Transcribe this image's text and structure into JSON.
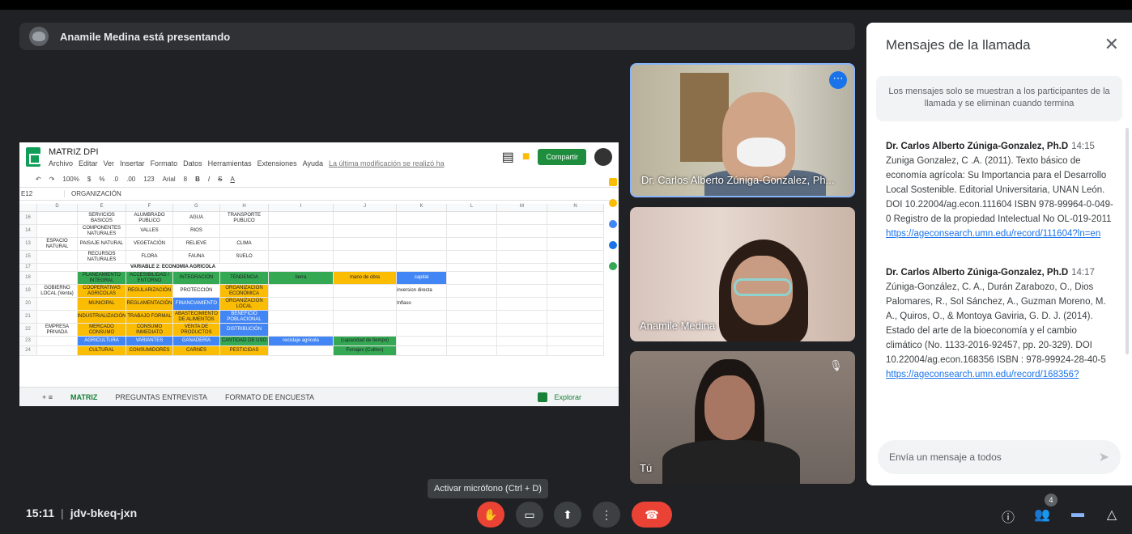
{
  "presenter": {
    "text": "Anamile Medina está presentando"
  },
  "sheet": {
    "title": "MATRIZ DPI",
    "menu": [
      "Archivo",
      "Editar",
      "Ver",
      "Insertar",
      "Formato",
      "Datos",
      "Herramientas",
      "Extensiones",
      "Ayuda"
    ],
    "last_edit": "La última modificación se realizó ha",
    "share_label": "Compartir",
    "toolbar": [
      "100%",
      "$",
      "%",
      ".0",
      ".00",
      "123",
      "Arial",
      "8",
      "B",
      "I",
      "S",
      "A"
    ],
    "cell_ref": "E12",
    "formula": "ORGANIZACIÓN",
    "columns": [
      "D",
      "E",
      "F",
      "G",
      "H",
      "I",
      "J",
      "K",
      "L",
      "M",
      "N"
    ],
    "rows": [
      {
        "n": "16",
        "D": "",
        "E": "SERVICIOS BASICOS",
        "F": "ALUMBRADO PUBLICO",
        "G": "AGUA",
        "H": "TRANSPORTE PUBLICO"
      },
      {
        "n": "14",
        "D": "",
        "E": "COMPONENTES NATURALES",
        "F": "VALLES",
        "G": "RIOS",
        "H": ""
      },
      {
        "n": "13",
        "D": "ESPACIO NATURAL",
        "E": "PAISAJE NATURAL",
        "F": "VEGETACIÓN",
        "G": "RELIEVE",
        "H": "CLIMA"
      },
      {
        "n": "15",
        "D": "",
        "E": "RECURSOS NATURALES",
        "F": "FLORA",
        "G": "FAUNA",
        "H": "SUELO"
      },
      {
        "n": "17",
        "D": "",
        "E": "VARIABLE 2: ECONOMÍA AGRÍCOLA",
        "F": "",
        "G": "",
        "H": ""
      },
      {
        "n": "18",
        "D": "",
        "E": "PLANEAMIENTO INTEGRAL",
        "F": "ACCESIBILIDAD / ENTORNO",
        "G": "INTEGRACIÓN",
        "H": "TENDENCIA",
        "I": "tierra",
        "J": "mano de obra",
        "K": "capital"
      },
      {
        "n": "19",
        "D": "GOBIERNO LOCAL (Venta)",
        "E": "COOPERATIVAS AGRICOLAS",
        "F": "REGULARIZACIÓN",
        "G": "PROTECCIÓN",
        "H": "ORGANIZACIÓN ECONÓMICA",
        "K": "inversion directa"
      },
      {
        "n": "20",
        "D": "",
        "E": "MUNICIPAL",
        "F": "REGLAMENTACIÓN",
        "G": "FINANCIAMIENTO",
        "H": "ORGANIZACIÓN LOCAL",
        "K": "Inflaso"
      },
      {
        "n": "21",
        "D": "",
        "E": "INDUSTRIALIZACIÓN",
        "F": "TRABAJO FORMAL",
        "G": "ABASTECIMIENTO DE ALIMENTOS",
        "H": "BENEFICIO POBLACIONAL"
      },
      {
        "n": "22",
        "D": "EMPRESA PRIVADA",
        "E": "MERCADO CONSUMO",
        "F": "CONSUMO INMEDIATO",
        "G": "VENTA DE PRODUCTOS",
        "H": "DISTRIBUCIÓN"
      },
      {
        "n": "23",
        "D": "",
        "E": "AGRICULTURA",
        "F": "VARIANTES",
        "G": "GANADERÍA",
        "H": "CANTIDAD DE USO",
        "I": "reciclaje agricola",
        "J": "(capacidad de tiempo)"
      },
      {
        "n": "24",
        "D": "",
        "E": "CULTURAL",
        "F": "CONSUMIDORES",
        "G": "CARNES",
        "H": "PESTICIDAS",
        "J": "Forrajes (Cultivo)"
      }
    ],
    "tabs": [
      "MATRIZ",
      "PREGUNTAS ENTREVISTA",
      "FORMATO DE ENCUESTA"
    ],
    "explore_label": "Explorar"
  },
  "participants": [
    {
      "name": "Dr. Carlos Alberto Zúniga-Gonzalez, Ph..."
    },
    {
      "name": "Anamile Medina"
    },
    {
      "name": "Tú"
    }
  ],
  "chat": {
    "title": "Mensajes de la llamada",
    "notice": "Los mensajes solo se muestran a los participantes de la llamada y se eliminan cuando termina",
    "messages": [
      {
        "sender": "Dr. Carlos Alberto Zúniga-Gonzalez, Ph.D",
        "time": "14:15",
        "text": "Zuniga Gonzalez, C .A. (2011). Texto básico de economía agrícola: Su Importancia para el Desarrollo Local Sostenible. Editorial Universitaria, UNAN León.  DOI 10.22004/ag.econ.111604 ISBN 978-99964-0-049-0 Registro de la propiedad Intelectual No OL-019-2011",
        "link": "https://ageconsearch.umn.edu/record/111604?ln=en"
      },
      {
        "sender": "Dr. Carlos Alberto Zúniga-Gonzalez, Ph.D",
        "time": "14:17",
        "text": "Zúniga-González, C. A., Durán Zarabozo, O., Dios Palomares, R., Sol Sánchez, A., Guzman Moreno, M. A., Quiros, O., & Montoya Gaviria, G. D. J. (2014). Estado del arte de la bioeconomía y el cambio climático (No. 1133-2016-92457, pp. 20-329). DOI 10.22004/ag.econ.168356 ISBN : 978-99924-28-40-5",
        "link": "https://ageconsearch.umn.edu/record/168356?"
      }
    ],
    "input_placeholder": "Envía un mensaje a todos"
  },
  "bottom": {
    "time": "15:11",
    "meeting_code": "jdv-bkeq-jxn",
    "tooltip": "Activar micrófono (Ctrl + D)",
    "participants_count": "4"
  },
  "icons": {
    "mic": "mic-off-icon",
    "camera": "camera-icon",
    "present": "present-icon",
    "more": "more-vert-icon",
    "end": "call-end-icon",
    "info": "info-icon",
    "people": "people-icon",
    "chat": "chat-icon",
    "activities": "activities-icon"
  }
}
